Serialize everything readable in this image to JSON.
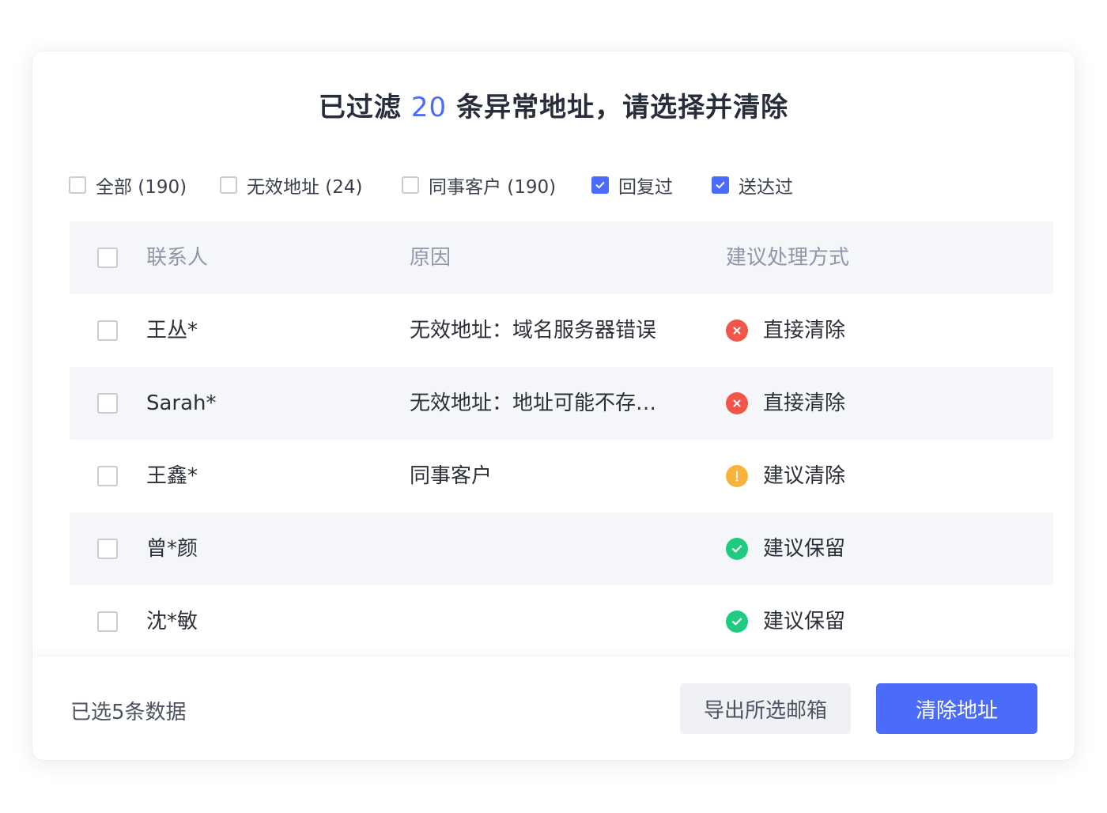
{
  "dialog": {
    "title_prefix": "已过滤",
    "title_count": "20",
    "title_suffix": "条异常地址，请选择并清除"
  },
  "filters": [
    {
      "label": "全部 (190)",
      "checked": false
    },
    {
      "label": "无效地址 (24)",
      "checked": false
    },
    {
      "label": "同事客户 (190)",
      "checked": false
    },
    {
      "label": "回复过",
      "checked": true
    },
    {
      "label": "送达过",
      "checked": true
    }
  ],
  "table": {
    "headers": {
      "contact": "联系人",
      "reason": "原因",
      "action": "建议处理方式"
    },
    "rows": [
      {
        "contact": "王丛*",
        "reason": "无效地址：域名服务器错误",
        "action": "直接清除",
        "status": "error",
        "checked": false
      },
      {
        "contact": "Sarah*",
        "reason": "无效地址：地址可能不存…",
        "action": "直接清除",
        "status": "error",
        "checked": false
      },
      {
        "contact": "王鑫*",
        "reason": "同事客户",
        "action": "建议清除",
        "status": "warning",
        "checked": false
      },
      {
        "contact": "曾*颜",
        "reason": "",
        "action": "建议保留",
        "status": "ok",
        "checked": false
      },
      {
        "contact": "沈*敏",
        "reason": "",
        "action": "建议保留",
        "status": "ok",
        "checked": false
      }
    ]
  },
  "footer": {
    "selected_text": "已选5条数据",
    "export_label": "导出所选邮箱",
    "clear_label": "清除地址"
  },
  "colors": {
    "accent": "#4b6bfb",
    "error": "#f2564b",
    "warning": "#f8b33c",
    "ok": "#1fcc7f"
  },
  "icons": {
    "error": "close-circle-icon",
    "warning": "exclamation-circle-icon",
    "ok": "check-circle-icon"
  }
}
